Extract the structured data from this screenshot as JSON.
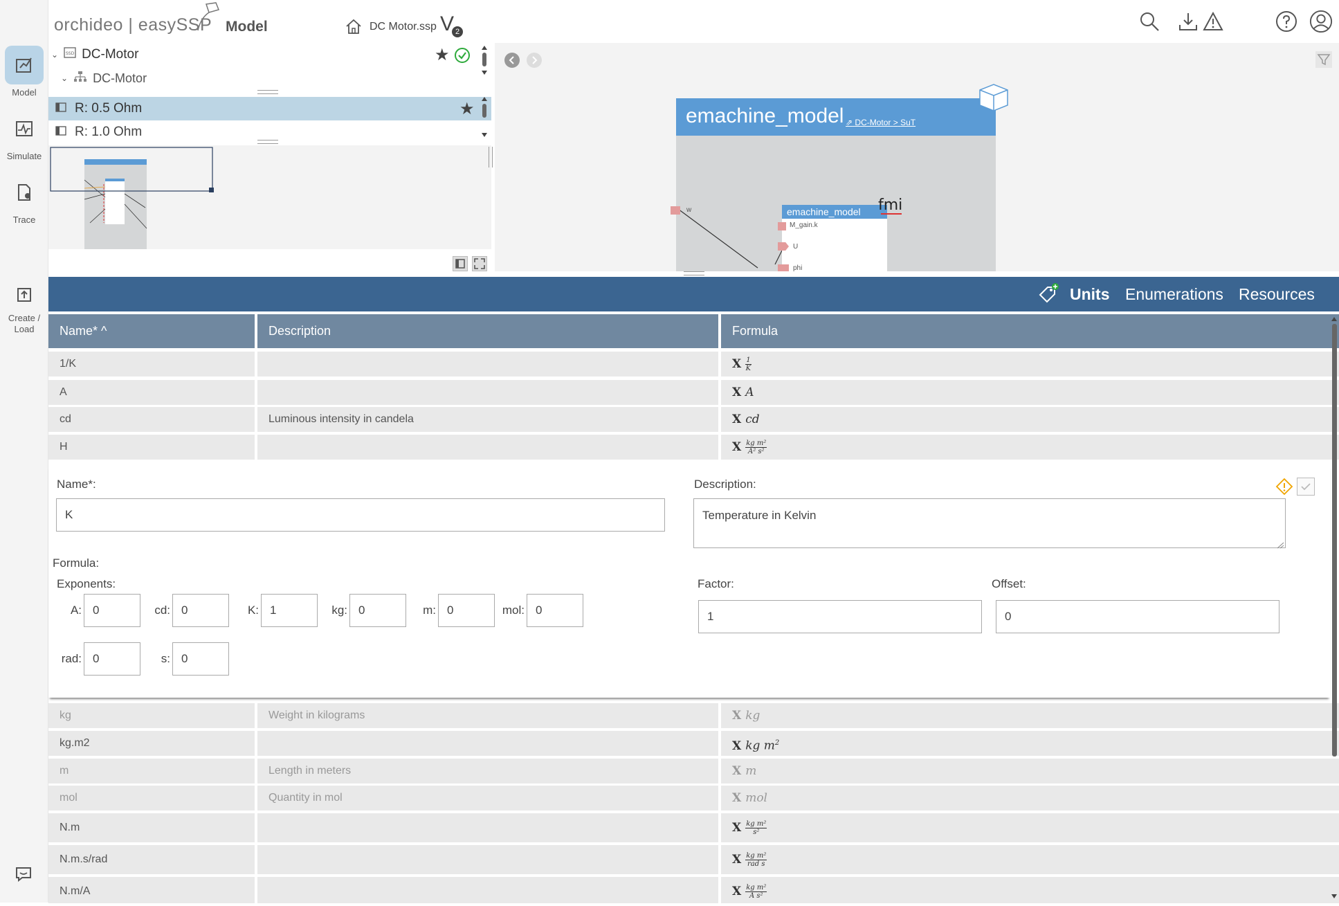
{
  "rail": {
    "items": [
      {
        "label": "Model"
      },
      {
        "label": "Simulate"
      },
      {
        "label": "Trace"
      },
      {
        "label": "Create /\nLoad"
      }
    ]
  },
  "header": {
    "brand": "orchideo | easySSP",
    "mode": "Model",
    "file_name": "DC Motor.ssp",
    "version_letter": "V",
    "version_num": "2"
  },
  "tree": {
    "rows": [
      {
        "label": "DC-Motor"
      },
      {
        "label": "DC-Motor"
      },
      {
        "label": "R: 0.5 Ohm"
      },
      {
        "label": "R: 1.0 Ohm"
      }
    ]
  },
  "canvas": {
    "system_name": "emachine_model",
    "breadcrumb_a": "DC-Motor",
    "breadcrumb_sep": ">",
    "breadcrumb_b": "SuT",
    "component_name": "emachine_model",
    "fmi_label": "fmi",
    "ports": [
      "w",
      "M_gain.k",
      "U",
      "phi"
    ]
  },
  "units_bar": {
    "tabs": [
      "Units",
      "Enumerations",
      "Resources"
    ],
    "active": "Units"
  },
  "table": {
    "headers": {
      "name": "Name* ^",
      "description": "Description",
      "formula": "Formula"
    },
    "rows_top": [
      {
        "name": "1/K",
        "description": "",
        "formula": "1/K"
      },
      {
        "name": "A",
        "description": "",
        "formula": "A"
      },
      {
        "name": "cd",
        "description": "Luminous intensity in candela",
        "formula": "cd"
      },
      {
        "name": "H",
        "description": "",
        "formula": "kg m²/A² s²"
      }
    ],
    "rows_bottom": [
      {
        "name": "kg",
        "description": "Weight in kilograms",
        "formula": "kg"
      },
      {
        "name": "kg.m2",
        "description": "",
        "formula": "kg m²"
      },
      {
        "name": "m",
        "description": "Length in meters",
        "formula": "m"
      },
      {
        "name": "mol",
        "description": "Quantity in mol",
        "formula": "mol"
      },
      {
        "name": "N.m",
        "description": "",
        "formula": "kg m²/s²"
      },
      {
        "name": "N.m.s/rad",
        "description": "",
        "formula": "kg m²/rad s"
      },
      {
        "name": "N.m/A",
        "description": "",
        "formula": "kg m²/A s²"
      }
    ]
  },
  "editor": {
    "name_label": "Name*:",
    "name_value": "K",
    "description_label": "Description:",
    "description_value": "Temperature in Kelvin",
    "formula_label": "Formula:",
    "exponents_label": "Exponents:",
    "exponents": [
      {
        "label": "A:",
        "value": "0"
      },
      {
        "label": "cd:",
        "value": "0"
      },
      {
        "label": "K:",
        "value": "1"
      },
      {
        "label": "kg:",
        "value": "0"
      },
      {
        "label": "m:",
        "value": "0"
      },
      {
        "label": "mol:",
        "value": "0"
      },
      {
        "label": "rad:",
        "value": "0"
      },
      {
        "label": "s:",
        "value": "0"
      }
    ],
    "factor_label": "Factor:",
    "factor_value": "1",
    "offset_label": "Offset:",
    "offset_value": "0"
  },
  "colors": {
    "units_bar": "#3b6591",
    "table_header": "#7088a0",
    "system_title": "#5b9bd5",
    "selected_row": "#bcd5e4",
    "ok_green": "#2eaa3c",
    "warn_amber": "#f0a500"
  }
}
